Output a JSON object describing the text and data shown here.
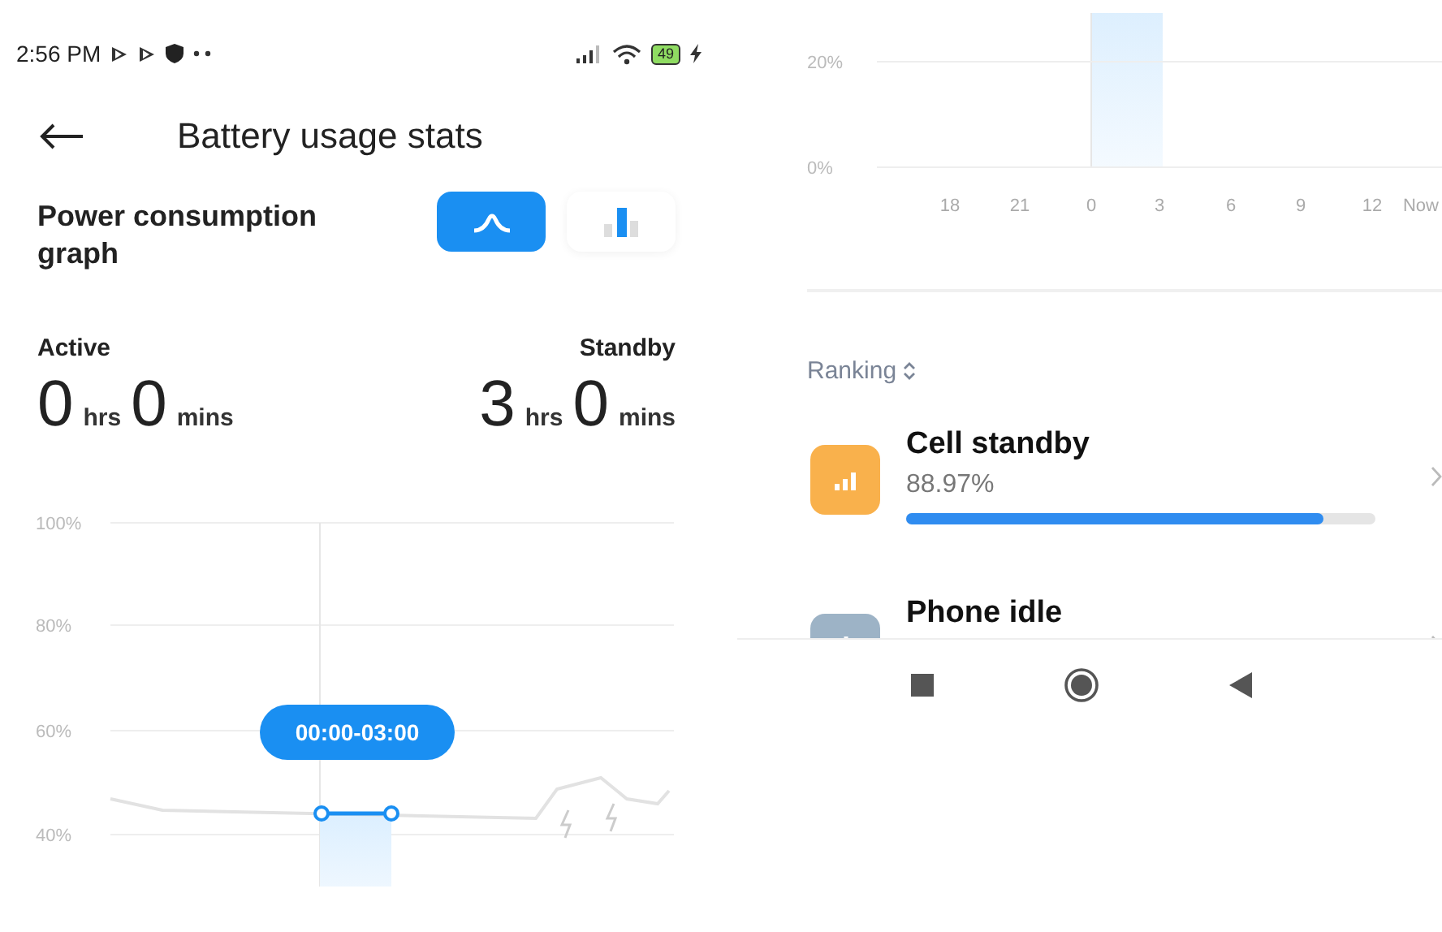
{
  "status_bar": {
    "time": "2:56 PM",
    "battery_text": "49"
  },
  "header": {
    "title": "Battery usage stats"
  },
  "graph_section": {
    "title": "Power consumption graph",
    "modes": [
      {
        "kind": "curve",
        "selected": true
      },
      {
        "kind": "bars",
        "selected": false
      }
    ]
  },
  "stats": [
    {
      "label": "Active",
      "hours": "0",
      "hours_unit": "hrs",
      "minutes": "0",
      "minutes_unit": "mins"
    },
    {
      "label": "Standby",
      "hours": "3",
      "hours_unit": "hrs",
      "minutes": "0",
      "minutes_unit": "mins"
    }
  ],
  "battery_chart": {
    "y_tick_labels": [
      "100%",
      "80%",
      "60%",
      "40%"
    ],
    "selection_label": "00:00-03:00"
  },
  "usage_chart": {
    "y_tick_labels": [
      "20%",
      "0%"
    ],
    "x_tick_labels": [
      "18",
      "21",
      "0",
      "3",
      "6",
      "9",
      "12",
      "Now"
    ]
  },
  "ranking": {
    "label": "Ranking"
  },
  "apps": [
    {
      "kind": "signal",
      "color": "#f9b14c",
      "name": "Cell standby",
      "percent": "88.97%",
      "level": 0.8897
    },
    {
      "kind": "power",
      "color": "#9db3c6",
      "name": "Phone idle"
    }
  ]
}
